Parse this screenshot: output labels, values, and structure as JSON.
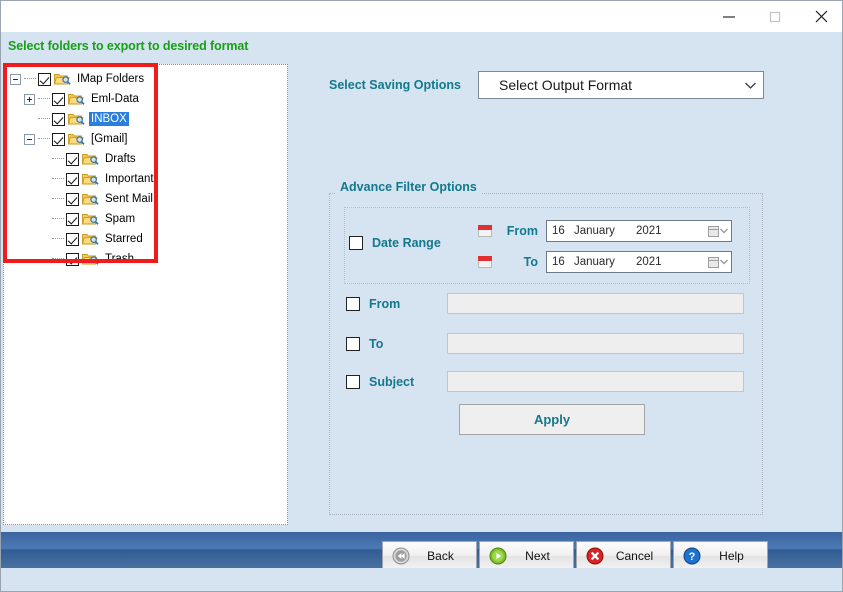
{
  "window": {
    "controls": {
      "minimize": "minimize-icon",
      "maximize": "maximize-icon",
      "close": "close-icon"
    }
  },
  "header": {
    "title": "Select folders to export to desired format",
    "title_color": "#18a018"
  },
  "tree": {
    "nodes": [
      {
        "label": "IMap Folders",
        "level": 0,
        "expander": "minus",
        "checked": true,
        "selected": false
      },
      {
        "label": "Eml-Data",
        "level": 1,
        "expander": "plus",
        "checked": true,
        "selected": false
      },
      {
        "label": "INBOX",
        "level": 1,
        "expander": "none",
        "checked": true,
        "selected": true
      },
      {
        "label": "[Gmail]",
        "level": 1,
        "expander": "minus",
        "checked": true,
        "selected": false
      },
      {
        "label": "Drafts",
        "level": 2,
        "expander": "none",
        "checked": true,
        "selected": false
      },
      {
        "label": "Important",
        "level": 2,
        "expander": "none",
        "checked": true,
        "selected": false
      },
      {
        "label": "Sent Mail",
        "level": 2,
        "expander": "none",
        "checked": true,
        "selected": false
      },
      {
        "label": "Spam",
        "level": 2,
        "expander": "none",
        "checked": true,
        "selected": false
      },
      {
        "label": "Starred",
        "level": 2,
        "expander": "none",
        "checked": true,
        "selected": false
      },
      {
        "label": "Trash",
        "level": 2,
        "expander": "none",
        "checked": true,
        "selected": false
      }
    ],
    "highlight_color": "#2a7fdc",
    "annotation_color": "#f01c1c"
  },
  "saving": {
    "label": "Select Saving Options",
    "format_value": "Select Output Format",
    "label_color": "#13798c"
  },
  "filter": {
    "group_title": "Advance Filter Options",
    "date_range_label": "Date Range",
    "date_range_checked": false,
    "from_date_label": "From",
    "to_date_label": "To",
    "from_date": {
      "day": "16",
      "month": "January",
      "year": "2021"
    },
    "to_date": {
      "day": "16",
      "month": "January",
      "year": "2021"
    },
    "from_label": "From",
    "from_value": "",
    "from_checked": false,
    "to_label": "To",
    "to_value": "",
    "to_checked": false,
    "subject_label": "Subject",
    "subject_value": "",
    "subject_checked": false,
    "apply_label": "Apply"
  },
  "footer": {
    "buttons": [
      {
        "label": "Back",
        "icon": "rewind-icon"
      },
      {
        "label": "Next",
        "icon": "play-icon"
      },
      {
        "label": "Cancel",
        "icon": "cancel-icon"
      },
      {
        "label": "Help",
        "icon": "help-icon"
      }
    ]
  }
}
